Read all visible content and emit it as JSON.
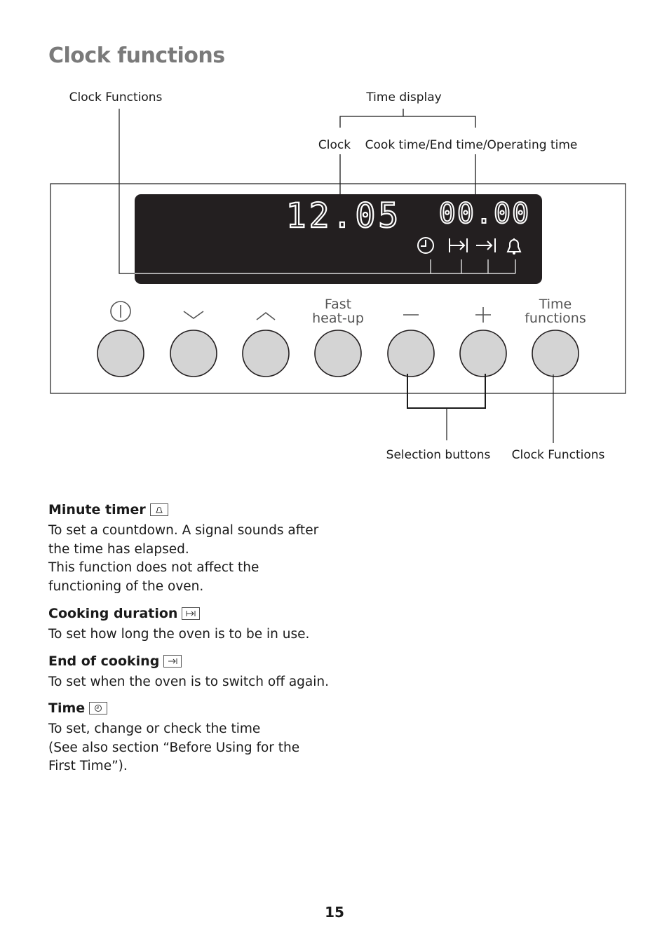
{
  "page": {
    "title": "Clock functions",
    "number": "15"
  },
  "diagram": {
    "labels": {
      "clock_functions_top": "Clock Functions",
      "time_display": "Time display",
      "clock": "Clock",
      "cook_time": "Cook time/End time/Operating time",
      "selection_buttons": "Selection buttons",
      "clock_functions_bottom": "Clock Functions"
    },
    "display": {
      "clock_value": "12.05",
      "timer_value": "00.00",
      "indicators": [
        "clock-icon",
        "cooking-duration-icon",
        "end-of-cooking-icon",
        "bell-icon"
      ]
    },
    "buttons": [
      {
        "name": "power",
        "icon": "power-icon"
      },
      {
        "name": "down",
        "icon": "chevron-down-icon"
      },
      {
        "name": "up",
        "icon": "chevron-up-icon"
      },
      {
        "name": "fast-heat-up",
        "label_line1": "Fast",
        "label_line2": "heat-up"
      },
      {
        "name": "minus",
        "icon": "minus-icon"
      },
      {
        "name": "plus",
        "icon": "plus-icon"
      },
      {
        "name": "time-functions",
        "label_line1": "Time",
        "label_line2": "functions"
      }
    ]
  },
  "sections": [
    {
      "heading": "Minute timer",
      "icon": "bell-icon",
      "lines": [
        "To set a countdown. A signal sounds after the time has elapsed.",
        "This function does not affect the functioning of the oven."
      ]
    },
    {
      "heading": "Cooking duration",
      "icon": "cooking-duration-icon",
      "lines": [
        "To set how long the oven is to be in use."
      ]
    },
    {
      "heading": "End of cooking",
      "icon": "end-of-cooking-icon",
      "lines": [
        "To set when the oven is to switch off again."
      ]
    },
    {
      "heading": "Time",
      "icon": "clock-icon",
      "lines": [
        "To set, change or check the time",
        "(See also section “Before Using for the First Time”)."
      ]
    }
  ]
}
